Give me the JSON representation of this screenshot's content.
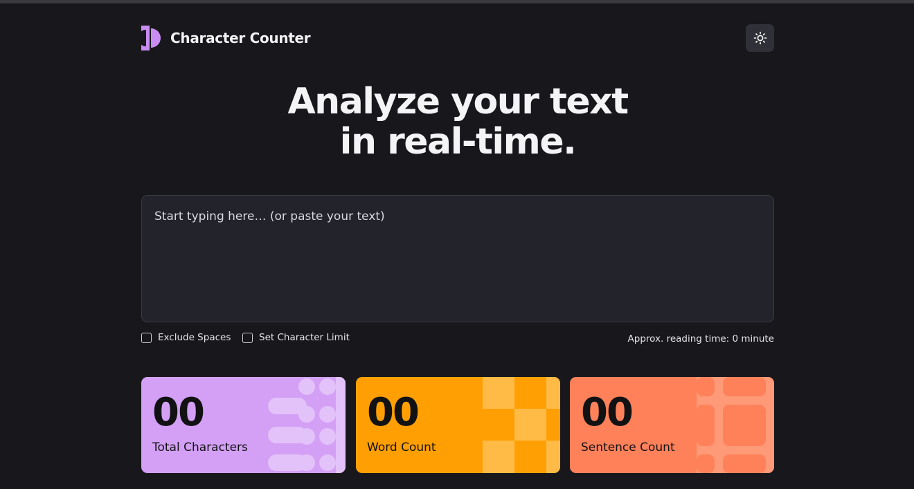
{
  "app": {
    "title": "Character Counter"
  },
  "hero": {
    "line1": "Analyze your text",
    "line2": "in real-time."
  },
  "editor": {
    "value": "",
    "placeholder": "Start typing here… (or paste your text)"
  },
  "options": {
    "exclude_spaces": {
      "label": "Exclude Spaces",
      "checked": false
    },
    "character_limit": {
      "label": "Set Character Limit",
      "checked": false
    },
    "reading_time": "Approx. reading time: 0 minute"
  },
  "stats": [
    {
      "value": "00",
      "label": "Total Characters",
      "color": "#d3a0f5"
    },
    {
      "value": "00",
      "label": "Word Count",
      "color": "#ff9f04"
    },
    {
      "value": "00",
      "label": "Sentence Count",
      "color": "#fe8159"
    }
  ],
  "colors": {
    "background": "#18181c",
    "surface": "#23232c",
    "toggle_bg": "#2f3038",
    "logo_accent": "#c98cf2"
  },
  "icons": {
    "logo": "character-counter-logo",
    "theme_toggle": "sun-icon"
  }
}
